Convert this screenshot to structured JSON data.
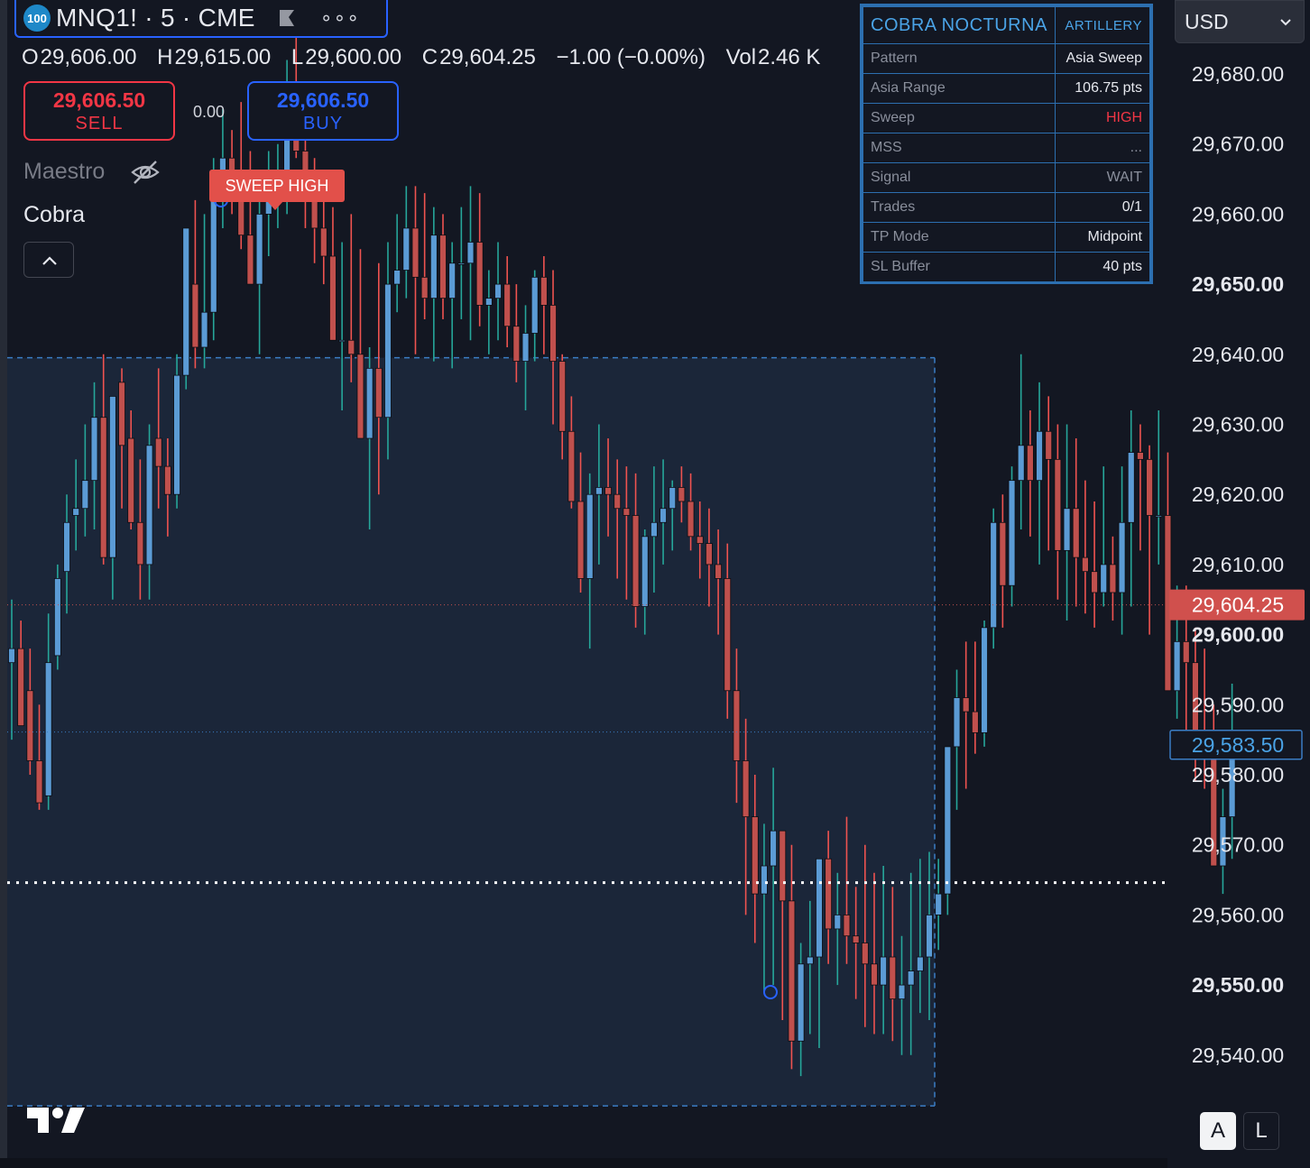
{
  "header": {
    "badge": "100",
    "symbol": "MNQ1! · 5 · CME",
    "more": "∘∘∘"
  },
  "ohlc": {
    "o_label": "O",
    "o": "29,606.00",
    "h_label": "H",
    "h": "29,615.00",
    "l_label": "L",
    "l": "29,600.00",
    "c_label": "C",
    "c": "29,604.25",
    "change": "−1.00 (−0.00%)",
    "vol_label": "Vol",
    "vol": "2.46 K"
  },
  "trade": {
    "sell_price": "29,606.50",
    "sell_label": "SELL",
    "buy_price": "29,606.50",
    "buy_label": "BUY",
    "spread": "0.00"
  },
  "indicators": {
    "maestro": "Maestro",
    "cobra": "Cobra"
  },
  "sweep_label": "SWEEP HIGH",
  "panel": {
    "title": "COBRA NOCTURNA",
    "subtitle": "ARTILLERY",
    "rows": [
      {
        "label": "Pattern",
        "value": "Asia Sweep"
      },
      {
        "label": "Asia Range",
        "value": "106.75 pts"
      },
      {
        "label": "Sweep",
        "value": "HIGH"
      },
      {
        "label": "MSS",
        "value": "..."
      },
      {
        "label": "Signal",
        "value": "WAIT"
      },
      {
        "label": "Trades",
        "value": "0/1"
      },
      {
        "label": "TP Mode",
        "value": "Midpoint"
      },
      {
        "label": "SL Buffer",
        "value": "40 pts"
      }
    ]
  },
  "currency": "USD",
  "scale_buttons": {
    "a": "A",
    "l": "L"
  },
  "colors": {
    "background": "#131722",
    "up": "#5b9bd5",
    "down": "#c0504d",
    "wick_up": "#26a69a",
    "wick_down": "#ef5350",
    "asia_box_fill": "#1b2639",
    "asia_box_border": "#3b7dc4",
    "last_price_bg": "#d0504d",
    "crosshair_price_border": "#3b7dc4"
  },
  "chart_data": {
    "type": "candlestick",
    "y_ticks": [
      "29,680.00",
      "29,670.00",
      "29,660.00",
      "29,650.00",
      "29,640.00",
      "29,630.00",
      "29,620.00",
      "29,610.00",
      "29,600.00",
      "29,590.00",
      "29,580.00",
      "29,570.00",
      "29,560.00",
      "29,550.00",
      "29,540.00"
    ],
    "ylim": [
      29533,
      29687
    ],
    "last_price": "29,604.25",
    "crosshair_price": "29,583.50",
    "asia_range": {
      "high": 29639.5,
      "low": 29532.75
    },
    "midpoint_line": 29586.1,
    "target_line": 29564.6,
    "candles": [
      [
        29596,
        29605,
        29585,
        29598
      ],
      [
        29598,
        29602,
        29588,
        29587
      ],
      [
        29592,
        29598,
        29580,
        29582
      ],
      [
        29582,
        29590,
        29575,
        29576
      ],
      [
        29577,
        29603,
        29575,
        29596
      ],
      [
        29597,
        29610,
        29595,
        29608
      ],
      [
        29609,
        29620,
        29603,
        29616
      ],
      [
        29617,
        29625,
        29612,
        29618
      ],
      [
        29618,
        29630,
        29614,
        29622
      ],
      [
        29622,
        29636,
        29615,
        29631
      ],
      [
        29631,
        29640,
        29610,
        29611
      ],
      [
        29611,
        29632,
        29605,
        29634
      ],
      [
        29636,
        29638,
        29618,
        29627
      ],
      [
        29628,
        29632,
        29615,
        29616
      ],
      [
        29616,
        29625,
        29605,
        29610
      ],
      [
        29610,
        29630,
        29605,
        29627
      ],
      [
        29628,
        29638,
        29618,
        29624
      ],
      [
        29624,
        29628,
        29614,
        29620
      ],
      [
        29620,
        29640,
        29618,
        29637
      ],
      [
        29637,
        29655,
        29635,
        29658
      ],
      [
        29650,
        29662,
        29638,
        29641
      ],
      [
        29641,
        29660,
        29638,
        29646
      ],
      [
        29646,
        29668,
        29642,
        29663
      ],
      [
        29663,
        29675,
        29658,
        29668
      ],
      [
        29668,
        29672,
        29660,
        29662
      ],
      [
        29662,
        29676,
        29655,
        29657
      ],
      [
        29657,
        29669,
        29650,
        29650
      ],
      [
        29650,
        29664,
        29640,
        29660
      ],
      [
        29660,
        29669,
        29654,
        29664
      ],
      [
        29664,
        29670,
        29658,
        29665
      ],
      [
        29665,
        29682,
        29660,
        29675
      ],
      [
        29675,
        29688,
        29668,
        29669
      ],
      [
        29669,
        29674,
        29658,
        29663
      ],
      [
        29663,
        29668,
        29653,
        29658
      ],
      [
        29658,
        29664,
        29650,
        29654
      ],
      [
        29654,
        29661,
        29645,
        29642
      ],
      [
        29642,
        29656,
        29632,
        29642
      ],
      [
        29642,
        29660,
        29636,
        29640
      ],
      [
        29640,
        29655,
        29630,
        29628
      ],
      [
        29628,
        29641,
        29615,
        29638
      ],
      [
        29638,
        29653,
        29620,
        29631
      ],
      [
        29631,
        29656,
        29625,
        29650
      ],
      [
        29650,
        29660,
        29646,
        29652
      ],
      [
        29652,
        29664,
        29648,
        29658
      ],
      [
        29658,
        29664,
        29640,
        29651
      ],
      [
        29651,
        29663,
        29645,
        29648
      ],
      [
        29648,
        29661,
        29639,
        29657
      ],
      [
        29657,
        29660,
        29645,
        29648
      ],
      [
        29648,
        29656,
        29638,
        29653
      ],
      [
        29653,
        29661,
        29645,
        29653
      ],
      [
        29653,
        29664,
        29642,
        29656
      ],
      [
        29656,
        29663,
        29644,
        29647
      ],
      [
        29647,
        29652,
        29640,
        29648
      ],
      [
        29648,
        29656,
        29642,
        29650
      ],
      [
        29650,
        29654,
        29641,
        29644
      ],
      [
        29644,
        29650,
        29636,
        29639
      ],
      [
        29639,
        29647,
        29632,
        29643
      ],
      [
        29643,
        29652,
        29639,
        29651
      ],
      [
        29651,
        29654,
        29640,
        29647
      ],
      [
        29647,
        29652,
        29630,
        29639
      ],
      [
        29639,
        29640,
        29625,
        29629
      ],
      [
        29629,
        29634,
        29618,
        29619
      ],
      [
        29619,
        29626,
        29606,
        29608
      ],
      [
        29608,
        29623,
        29598,
        29620
      ],
      [
        29620,
        29630,
        29610,
        29621
      ],
      [
        29621,
        29628,
        29614,
        29620
      ],
      [
        29620,
        29625,
        29608,
        29618
      ],
      [
        29618,
        29624,
        29605,
        29617
      ],
      [
        29617,
        29623,
        29601,
        29604
      ],
      [
        29604,
        29615,
        29600,
        29614
      ],
      [
        29614,
        29624,
        29606,
        29616
      ],
      [
        29616,
        29625,
        29610,
        29618
      ],
      [
        29618,
        29622,
        29612,
        29621
      ],
      [
        29621,
        29624,
        29616,
        29619
      ],
      [
        29619,
        29623,
        29612,
        29614
      ],
      [
        29614,
        29619,
        29608,
        29613
      ],
      [
        29613,
        29618,
        29604,
        29610
      ],
      [
        29610,
        29615,
        29600,
        29608
      ],
      [
        29608,
        29613,
        29588,
        29592
      ],
      [
        29592,
        29598,
        29576,
        29582
      ],
      [
        29582,
        29588,
        29560,
        29574
      ],
      [
        29574,
        29580,
        29556,
        29563
      ],
      [
        29563,
        29573,
        29549,
        29567
      ],
      [
        29567,
        29581,
        29550,
        29572
      ],
      [
        29572,
        29570,
        29545,
        29562
      ],
      [
        29562,
        29570,
        29538,
        29542
      ],
      [
        29542,
        29556,
        29537,
        29553
      ],
      [
        29553,
        29562,
        29543,
        29554
      ],
      [
        29554,
        29566,
        29541,
        29568
      ],
      [
        29568,
        29572,
        29553,
        29558
      ],
      [
        29558,
        29566,
        29550,
        29560
      ],
      [
        29560,
        29574,
        29553,
        29557
      ],
      [
        29557,
        29564,
        29548,
        29556
      ],
      [
        29556,
        29570,
        29544,
        29553
      ],
      [
        29553,
        29566,
        29543,
        29550
      ],
      [
        29550,
        29567,
        29543,
        29554
      ],
      [
        29554,
        29564,
        29542,
        29548
      ],
      [
        29548,
        29557,
        29540,
        29550
      ],
      [
        29550,
        29566,
        29540,
        29552
      ],
      [
        29552,
        29568,
        29546,
        29554
      ],
      [
        29554,
        29569,
        29545,
        29560
      ],
      [
        29560,
        29568,
        29555,
        29563
      ],
      [
        29563,
        29583,
        29560,
        29584
      ],
      [
        29584,
        29595,
        29575,
        29591
      ],
      [
        29591,
        29599,
        29578,
        29589
      ],
      [
        29589,
        29599,
        29583,
        29586
      ],
      [
        29586,
        29602,
        29584,
        29601
      ],
      [
        29601,
        29618,
        29598,
        29616
      ],
      [
        29616,
        29620,
        29601,
        29607
      ],
      [
        29607,
        29624,
        29604,
        29622
      ],
      [
        29622,
        29640,
        29615,
        29627
      ],
      [
        29627,
        29632,
        29614,
        29622
      ],
      [
        29622,
        29636,
        29610,
        29629
      ],
      [
        29629,
        29634,
        29612,
        29625
      ],
      [
        29625,
        29630,
        29605,
        29612
      ],
      [
        29612,
        29630,
        29602,
        29618
      ],
      [
        29618,
        29628,
        29604,
        29611
      ],
      [
        29611,
        29622,
        29603,
        29609
      ],
      [
        29609,
        29619,
        29601,
        29606
      ],
      [
        29606,
        29624,
        29604,
        29610
      ],
      [
        29610,
        29614,
        29602,
        29606
      ],
      [
        29606,
        29624,
        29600,
        29616
      ],
      [
        29616,
        29632,
        29604,
        29626
      ],
      [
        29626,
        29630,
        29612,
        29625
      ],
      [
        29625,
        29627,
        29600,
        29617
      ],
      [
        29617,
        29632,
        29610,
        29617
      ],
      [
        29617,
        29626,
        29592,
        29592
      ],
      [
        29592,
        29607,
        29588,
        29599
      ],
      [
        29599,
        29607,
        29585,
        29596
      ],
      [
        29596,
        29601,
        29579,
        29585
      ],
      [
        29585,
        29598,
        29578,
        29583
      ],
      [
        29583,
        29590,
        29568,
        29567
      ],
      [
        29567,
        29578,
        29563,
        29574
      ],
      [
        29574,
        29593,
        29568,
        29584
      ]
    ]
  }
}
